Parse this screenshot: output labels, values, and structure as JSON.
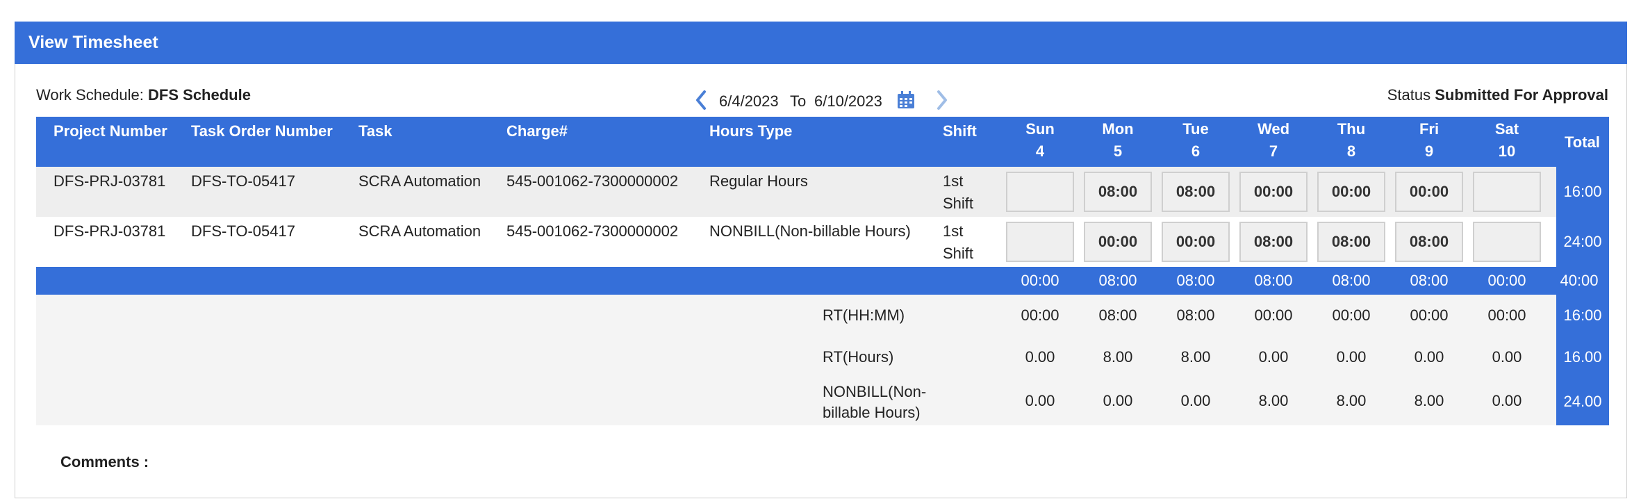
{
  "title": "View Timesheet",
  "work_schedule": {
    "label": "Work Schedule:",
    "value": "DFS Schedule"
  },
  "date_range": {
    "from": "6/4/2023",
    "to_label": "To",
    "to": "6/10/2023"
  },
  "status": {
    "label": "Status",
    "value": "Submitted For Approval"
  },
  "columns": {
    "project_number": "Project Number",
    "task_order_number": "Task Order Number",
    "task": "Task",
    "charge": "Charge#",
    "hours_type": "Hours Type",
    "shift": "Shift",
    "total": "Total"
  },
  "days": [
    {
      "name": "Sun",
      "date": "4"
    },
    {
      "name": "Mon",
      "date": "5"
    },
    {
      "name": "Tue",
      "date": "6"
    },
    {
      "name": "Wed",
      "date": "7"
    },
    {
      "name": "Thu",
      "date": "8"
    },
    {
      "name": "Fri",
      "date": "9"
    },
    {
      "name": "Sat",
      "date": "10"
    }
  ],
  "rows": [
    {
      "project_number": "DFS-PRJ-03781",
      "task_order_number": "DFS-TO-05417",
      "task": "SCRA Automation",
      "charge": "545-001062-7300000002",
      "hours_type": "Regular Hours",
      "shift_line1": "1st",
      "shift_line2": "Shift",
      "hours": [
        "",
        "08:00",
        "08:00",
        "00:00",
        "00:00",
        "00:00",
        ""
      ],
      "total": "16:00"
    },
    {
      "project_number": "DFS-PRJ-03781",
      "task_order_number": "DFS-TO-05417",
      "task": "SCRA Automation",
      "charge": "545-001062-7300000002",
      "hours_type": "NONBILL(Non-billable Hours)",
      "shift_line1": "1st",
      "shift_line2": "Shift",
      "hours": [
        "",
        "00:00",
        "00:00",
        "08:00",
        "08:00",
        "08:00",
        ""
      ],
      "total": "24:00"
    }
  ],
  "daily_totals": [
    "00:00",
    "08:00",
    "08:00",
    "08:00",
    "08:00",
    "08:00",
    "00:00"
  ],
  "grand_total": "40:00",
  "summary": [
    {
      "label": "RT(HH:MM)",
      "values": [
        "00:00",
        "08:00",
        "08:00",
        "00:00",
        "00:00",
        "00:00",
        "00:00"
      ],
      "total": "16:00"
    },
    {
      "label": "RT(Hours)",
      "values": [
        "0.00",
        "8.00",
        "8.00",
        "0.00",
        "0.00",
        "0.00",
        "0.00"
      ],
      "total": "16.00"
    },
    {
      "label_line1": "NONBILL(Non-",
      "label_line2": "billable Hours)",
      "values": [
        "0.00",
        "0.00",
        "0.00",
        "8.00",
        "8.00",
        "8.00",
        "0.00"
      ],
      "total": "24.00"
    }
  ],
  "comments_label": "Comments :",
  "icons": {
    "prev": "chevron-left-icon",
    "next": "chevron-right-icon",
    "calendar": "calendar-icon"
  },
  "colors": {
    "header_blue": "#356fd9",
    "nav_blue": "#4a7fd6",
    "nav_disabled": "#9fbde6"
  }
}
